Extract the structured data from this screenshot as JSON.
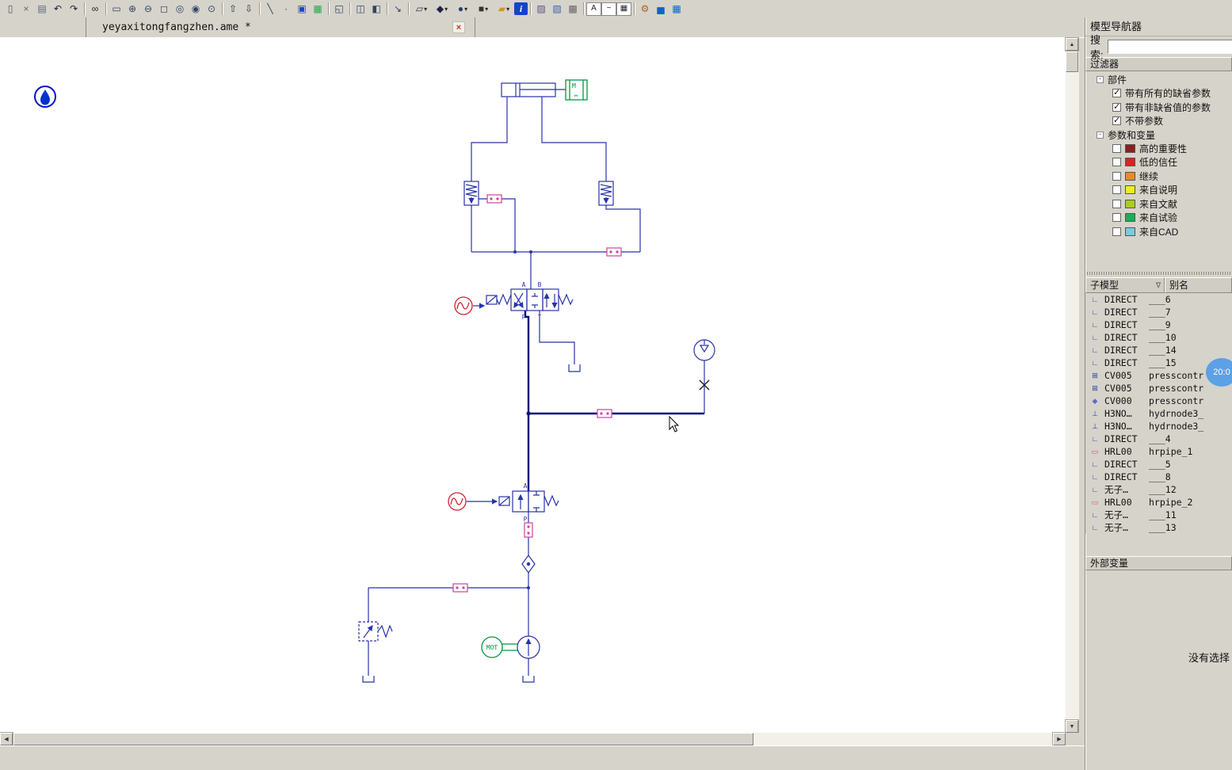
{
  "window": {
    "tab_filename": "yeyaxitongfangzhen.ame *",
    "tab_close_glyph": "×"
  },
  "toolbar": {
    "icons": [
      {
        "name": "new",
        "glyph": "▯",
        "color": "#556"
      },
      {
        "name": "cut",
        "glyph": "×",
        "color": "#667"
      },
      {
        "name": "stamp",
        "glyph": "▤",
        "color": "#567"
      },
      {
        "name": "undo",
        "glyph": "↶",
        "color": "#123"
      },
      {
        "name": "redo",
        "glyph": "↷",
        "color": "#123"
      },
      {
        "cls": "sep"
      },
      {
        "name": "find",
        "glyph": "∞",
        "color": "#123"
      },
      {
        "cls": "sep"
      },
      {
        "name": "zoom-page",
        "glyph": "▭",
        "color": "#346"
      },
      {
        "name": "zoom-in",
        "glyph": "⊕",
        "color": "#346"
      },
      {
        "name": "zoom-out",
        "glyph": "⊖",
        "color": "#346"
      },
      {
        "name": "zoom-window",
        "glyph": "◻",
        "color": "#346"
      },
      {
        "name": "zoom-fit",
        "glyph": "◎",
        "color": "#346"
      },
      {
        "name": "zoom-previous",
        "glyph": "◉",
        "color": "#346"
      },
      {
        "name": "zoom-selection",
        "glyph": "⊙",
        "color": "#346"
      },
      {
        "cls": "sep"
      },
      {
        "name": "move-up",
        "glyph": "⇧",
        "color": "#234"
      },
      {
        "name": "move-down",
        "glyph": "⇩",
        "color": "#234"
      },
      {
        "cls": "sep"
      },
      {
        "name": "line-tool",
        "glyph": "╲",
        "color": "#345"
      },
      {
        "name": "point-tool",
        "glyph": "·",
        "color": "#345"
      },
      {
        "name": "report",
        "glyph": "▣",
        "color": "#2244bb"
      },
      {
        "name": "image",
        "glyph": "▦",
        "color": "#22aa44"
      },
      {
        "cls": "sep"
      },
      {
        "name": "preview",
        "glyph": "◱",
        "color": "#346"
      },
      {
        "cls": "sep"
      },
      {
        "name": "window-split-h",
        "glyph": "◫",
        "color": "#346"
      },
      {
        "name": "window-split-v",
        "glyph": "◧",
        "color": "#346"
      },
      {
        "cls": "sep"
      },
      {
        "name": "export",
        "glyph": "↘",
        "color": "#346"
      },
      {
        "cls": "sep"
      },
      {
        "name": "sketch-mode",
        "glyph": "▱",
        "color": "#335",
        "cls": "drop"
      },
      {
        "name": "submodel-mode",
        "glyph": "◆",
        "color": "#224",
        "cls": "drop"
      },
      {
        "name": "parameter-mode",
        "glyph": "●",
        "color": "#246",
        "cls": "drop"
      },
      {
        "name": "run-mode",
        "glyph": "■",
        "color": "#333",
        "cls": "drop"
      },
      {
        "name": "batch-mode",
        "glyph": "▰",
        "color": "#cc9922",
        "cls": "drop"
      },
      {
        "name": "help",
        "glyph": "i",
        "color": "#ffffff",
        "cls": "badge-blue"
      },
      {
        "cls": "sep"
      },
      {
        "name": "post-image",
        "glyph": "▨",
        "color": "#558"
      },
      {
        "name": "post-chart",
        "glyph": "▧",
        "color": "#3366aa"
      },
      {
        "name": "post-settings",
        "glyph": "▩",
        "color": "#666"
      },
      {
        "cls": "sep"
      },
      {
        "name": "text-item",
        "glyph": "A",
        "color": "#223",
        "cls": "boxed"
      },
      {
        "name": "curve-item",
        "glyph": "~",
        "color": "#223",
        "cls": "boxed"
      },
      {
        "name": "table-item",
        "glyph": "▦",
        "color": "#223",
        "cls": "boxed"
      },
      {
        "cls": "sep"
      },
      {
        "name": "app-designer",
        "glyph": "⚙",
        "color": "#aa6611"
      },
      {
        "name": "plot-manager",
        "glyph": "▅",
        "color": "#0066cc"
      },
      {
        "name": "table-manager",
        "glyph": "▦",
        "color": "#0066cc"
      }
    ]
  },
  "canvas": {
    "diagram_labels": {
      "port_a": "A",
      "port_b": "B",
      "port_p": "P",
      "port_t": "T",
      "mass": "M",
      "mass_arrows": "↔",
      "motor": "MOT"
    }
  },
  "navigator": {
    "title": "模型导航器",
    "search_label": "搜索:",
    "search_value": "",
    "filter": {
      "title": "过滤器",
      "groups": [
        {
          "label": "部件",
          "items": [
            {
              "label": "带有所有的缺省参数",
              "checked": true
            },
            {
              "label": "带有非缺省值的参数",
              "checked": true
            },
            {
              "label": "不带参数",
              "checked": true
            }
          ]
        },
        {
          "label": "参数和变量",
          "items": [
            {
              "label": "高的重要性",
              "checked": false,
              "color": "#8b2020"
            },
            {
              "label": "低的信任",
              "checked": false,
              "color": "#dd2222"
            },
            {
              "label": "继续",
              "checked": false,
              "color": "#ee8822"
            },
            {
              "label": "来自说明",
              "checked": false,
              "color": "#eeee22"
            },
            {
              "label": "来自文献",
              "checked": false,
              "color": "#aacc22"
            },
            {
              "label": "来自试验",
              "checked": false,
              "color": "#22aa55"
            },
            {
              "label": "来自CAD",
              "checked": false,
              "color": "#77ccdd"
            }
          ]
        }
      ]
    },
    "submodel_table": {
      "col1": "子模型",
      "col2": "别名",
      "sort_glyph": "∇",
      "rows": [
        {
          "icon": "direct-submodel",
          "glyph": "∟",
          "color": "#2233aa",
          "submodel": "DIRECT",
          "alias": "___6"
        },
        {
          "icon": "direct-submodel",
          "glyph": "∟",
          "color": "#2233aa",
          "submodel": "DIRECT",
          "alias": "___7"
        },
        {
          "icon": "direct-submodel",
          "glyph": "∟",
          "color": "#2233aa",
          "submodel": "DIRECT",
          "alias": "___9"
        },
        {
          "icon": "direct-submodel",
          "glyph": "∟",
          "color": "#2233aa",
          "submodel": "DIRECT",
          "alias": "___10"
        },
        {
          "icon": "direct-submodel",
          "glyph": "∟",
          "color": "#2233aa",
          "submodel": "DIRECT",
          "alias": "___14"
        },
        {
          "icon": "direct-submodel",
          "glyph": "∟",
          "color": "#2233aa",
          "submodel": "DIRECT",
          "alias": "___15"
        },
        {
          "icon": "controlvalve-submodel",
          "glyph": "⊞",
          "color": "#2233aa",
          "submodel": "CV005",
          "alias": "presscontr"
        },
        {
          "icon": "controlvalve-submodel",
          "glyph": "⊞",
          "color": "#2233aa",
          "submodel": "CV005",
          "alias": "presscontr"
        },
        {
          "icon": "pressurecontrol-submodel",
          "glyph": "◆",
          "color": "#6666cc",
          "submodel": "CV000",
          "alias": "presscontr"
        },
        {
          "icon": "hydraulic-node",
          "glyph": "⊥",
          "color": "#2233aa",
          "submodel": "H3NO…",
          "alias": "hydrnode3_"
        },
        {
          "icon": "hydraulic-node",
          "glyph": "⊥",
          "color": "#2233aa",
          "submodel": "H3NO…",
          "alias": "hydrnode3_"
        },
        {
          "icon": "direct-submodel",
          "glyph": "∟",
          "color": "#2233aa",
          "submodel": "DIRECT",
          "alias": "___4"
        },
        {
          "icon": "hydraulic-pipe",
          "glyph": "▭",
          "color": "#cc4499",
          "submodel": "HRL00",
          "alias": "hrpipe_1"
        },
        {
          "icon": "direct-submodel",
          "glyph": "∟",
          "color": "#2233aa",
          "submodel": "DIRECT",
          "alias": "___5"
        },
        {
          "icon": "direct-submodel",
          "glyph": "∟",
          "color": "#2233aa",
          "submodel": "DIRECT",
          "alias": "___8"
        },
        {
          "icon": "no-submodel",
          "glyph": "∟",
          "color": "#2233aa",
          "submodel": "无子…",
          "alias": "___12"
        },
        {
          "icon": "hydraulic-pipe",
          "glyph": "▭",
          "color": "#cc4499",
          "submodel": "HRL00",
          "alias": "hrpipe_2"
        },
        {
          "icon": "no-submodel",
          "glyph": "∟",
          "color": "#2233aa",
          "submodel": "无子…",
          "alias": "___11"
        },
        {
          "icon": "no-submodel",
          "glyph": "∟",
          "color": "#2233aa",
          "submodel": "无子…",
          "alias": "___13"
        }
      ]
    },
    "external_title": "外部变量",
    "no_selection": "没有选择"
  },
  "overlay": {
    "badge_text": "20:0"
  },
  "ui": {
    "scroll_up": "▲",
    "scroll_down": "▼",
    "scroll_left": "◀",
    "scroll_right": "▶"
  }
}
